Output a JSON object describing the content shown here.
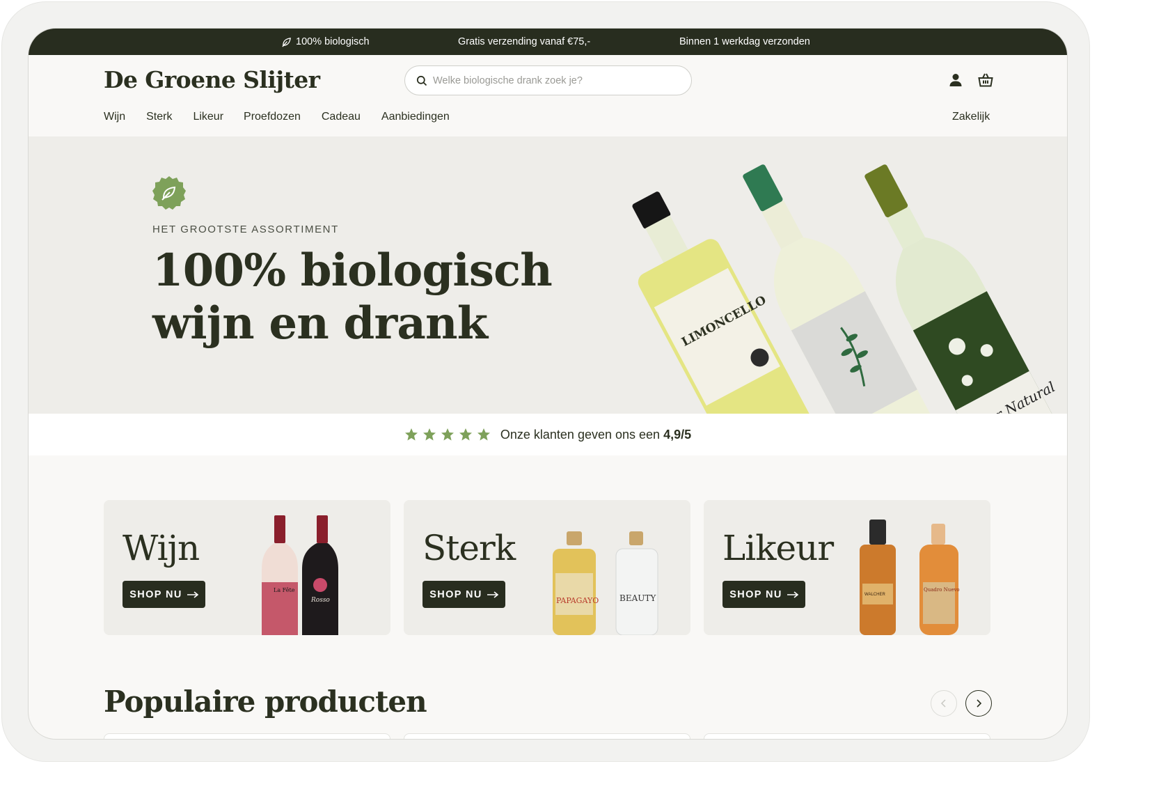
{
  "announcement": {
    "organic": "100% biologisch",
    "shipping": "Gratis verzending vanaf €75,-",
    "dispatch": "Binnen 1 werkdag verzonden"
  },
  "header": {
    "logo": "De Groene Slijter",
    "search_placeholder": "Welke biologische drank zoek je?",
    "nav": [
      "Wijn",
      "Sterk",
      "Likeur",
      "Proefdozen",
      "Cadeau",
      "Aanbiedingen"
    ],
    "business_link": "Zakelijk"
  },
  "hero": {
    "eyebrow": "HET GROOTSTE ASSORTIMENT",
    "headline_line1": "100% biologisch",
    "headline_line2": "wijn en drank",
    "bottle_labels": [
      "LIMONCELLO",
      "Flor Natural"
    ]
  },
  "rating": {
    "stars": 5,
    "text": "Onze klanten geven ons een",
    "score": "4,9/5"
  },
  "categories": [
    {
      "title": "Wijn",
      "cta": "SHOP NU",
      "bottle_labels": [
        "La Fête",
        "Rosso"
      ]
    },
    {
      "title": "Sterk",
      "cta": "SHOP NU",
      "bottle_labels": [
        "PAPAGAYO",
        "BEAUTY"
      ]
    },
    {
      "title": "Likeur",
      "cta": "SHOP NU",
      "bottle_labels": [
        "WALCHER",
        "Quadro Nuevo"
      ]
    }
  ],
  "popular": {
    "title": "Populaire producten"
  },
  "colors": {
    "dark_green": "#282d1f",
    "accent_green": "#7ea15a",
    "hero_bg": "#eeede9",
    "page_bg": "#f9f8f6"
  },
  "icons": [
    "leaf-icon",
    "search-icon",
    "account-icon",
    "cart-icon",
    "star-icon",
    "arrow-right-icon",
    "chevron-left-icon",
    "chevron-right-icon"
  ]
}
